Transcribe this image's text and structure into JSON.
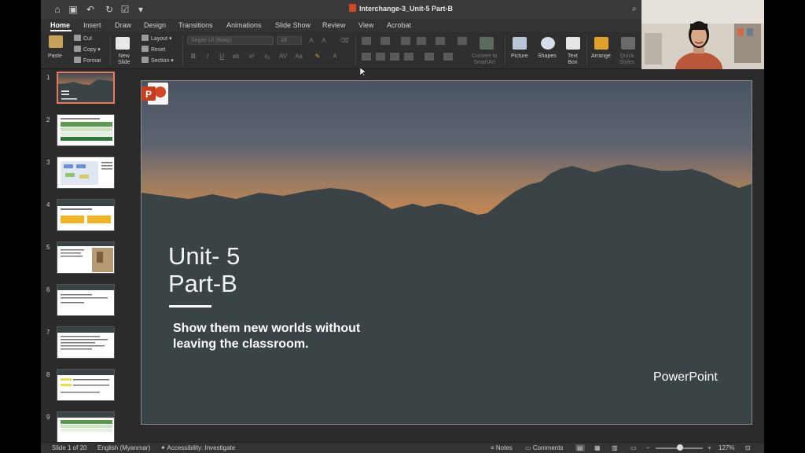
{
  "window": {
    "title": "Interchange-3_Unit-5 Part-B"
  },
  "quick_access": [
    "home-icon",
    "save-icon",
    "undo-icon",
    "redo-icon",
    "checkmark-icon",
    "more-icon"
  ],
  "tabs": [
    {
      "label": "Home",
      "active": true
    },
    {
      "label": "Insert"
    },
    {
      "label": "Draw"
    },
    {
      "label": "Design"
    },
    {
      "label": "Transitions"
    },
    {
      "label": "Animations"
    },
    {
      "label": "Slide Show"
    },
    {
      "label": "Review"
    },
    {
      "label": "View"
    },
    {
      "label": "Acrobat"
    }
  ],
  "ribbon": {
    "paste": "Paste",
    "cut": "Cut",
    "copy": "Copy",
    "format": "Format",
    "new_slide": "New\nSlide",
    "layout": "Layout",
    "reset": "Reset",
    "section": "Section",
    "font_name": "Segoe UI (Body)",
    "font_size": "18",
    "convert_smartart": "Convert to\nSmartArt",
    "picture": "Picture",
    "shapes": "Shapes",
    "text_box": "Text\nBox",
    "arrange": "Arrange",
    "quick_styles": "Quick\nStyles"
  },
  "thumbnails": [
    "1",
    "2",
    "3",
    "4",
    "5",
    "6",
    "7",
    "8",
    "9"
  ],
  "slide": {
    "title_line1": "Unit- 5",
    "title_line2": "Part-B",
    "subtitle_line1": "Show them new worlds without",
    "subtitle_line2": "leaving the classroom.",
    "brand": "PowerPoint"
  },
  "status": {
    "slide_position": "Slide 1 of 20",
    "language": "English (Myanmar)",
    "accessibility": "Accessibility: Investigate",
    "notes": "Notes",
    "comments": "Comments",
    "zoom": "127%"
  },
  "colors": {
    "accent_orange": "#d24726",
    "selection": "#e8795f",
    "slide_ground": "#3a4447"
  }
}
